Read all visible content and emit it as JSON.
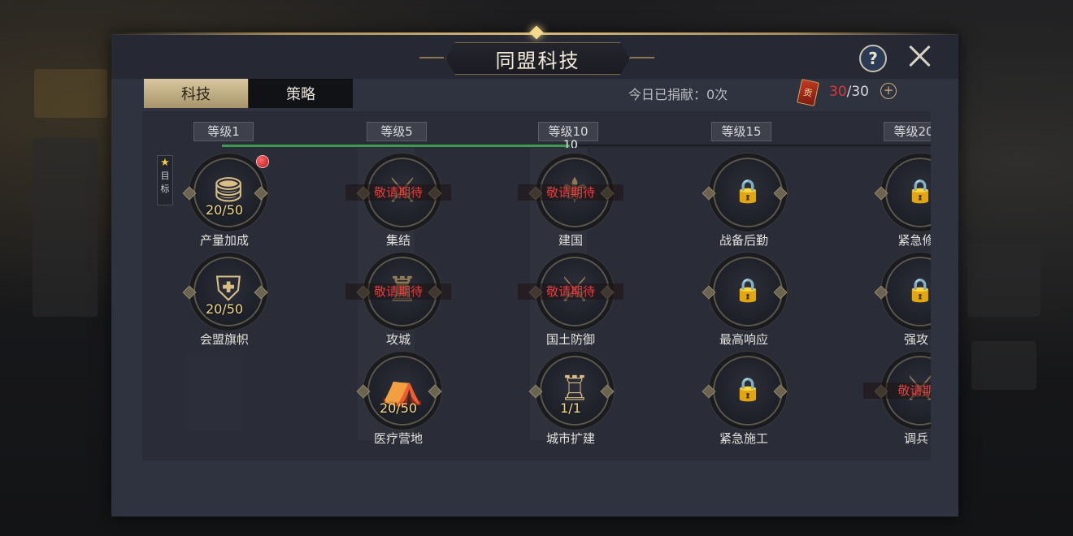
{
  "title": "同盟科技",
  "help_label": "?",
  "tabs": [
    {
      "label": "科技",
      "active": true
    },
    {
      "label": "策略",
      "active": false
    }
  ],
  "donate": {
    "text": "今日已捐献：0次",
    "card_glyph": "贡",
    "current": "30",
    "max": "/30",
    "plus_label": "+"
  },
  "target_badge": {
    "star": "★",
    "line1": "目",
    "line2": "标"
  },
  "levels": [
    "等级1",
    "等级5",
    "等级10",
    "等级15",
    "等级20"
  ],
  "progress": {
    "value": 10,
    "label": "10"
  },
  "nodes": [
    {
      "name": "产量加成",
      "progress": "20/50",
      "state": "active",
      "icon": "resource-boost-icon",
      "glyph": "⛃"
    },
    {
      "name": "会盟旗帜",
      "progress": "20/50",
      "state": "active",
      "icon": "alliance-banner-icon",
      "glyph": "⛨"
    },
    {
      "name": "集结",
      "soon": "敬请期待",
      "state": "coming-soon",
      "icon": "rally-icon",
      "glyph": "⚔"
    },
    {
      "name": "攻城",
      "soon": "敬请期待",
      "state": "coming-soon",
      "icon": "siege-icon",
      "glyph": "♜"
    },
    {
      "name": "医疗营地",
      "progress": "20/50",
      "state": "active",
      "icon": "medical-camp-icon",
      "glyph": "⛺"
    },
    {
      "name": "建国",
      "soon": "敬请期待",
      "state": "coming-soon",
      "icon": "found-nation-icon",
      "glyph": "⚜"
    },
    {
      "name": "国土防御",
      "soon": "敬请期待",
      "state": "coming-soon",
      "icon": "territory-defense-icon",
      "glyph": "⚔"
    },
    {
      "name": "城市扩建",
      "progress": "1/1",
      "state": "active",
      "icon": "city-expansion-icon",
      "glyph": "♖"
    },
    {
      "name": "战备后勤",
      "state": "locked",
      "icon": "logistics-icon",
      "glyph": "🔒"
    },
    {
      "name": "最高响应",
      "state": "locked",
      "icon": "max-response-icon",
      "glyph": "🔒"
    },
    {
      "name": "紧急施工",
      "state": "locked",
      "icon": "emergency-build-icon",
      "glyph": "🔒"
    },
    {
      "name": "紧急修",
      "state": "locked",
      "icon": "emergency-repair-icon",
      "glyph": "🔒"
    },
    {
      "name": "强攻",
      "state": "locked",
      "icon": "assault-icon",
      "glyph": "🔒"
    },
    {
      "name": "调兵",
      "soon": "敬请期",
      "state": "coming-soon",
      "icon": "troop-dispatch-icon",
      "glyph": "⚔"
    }
  ]
}
